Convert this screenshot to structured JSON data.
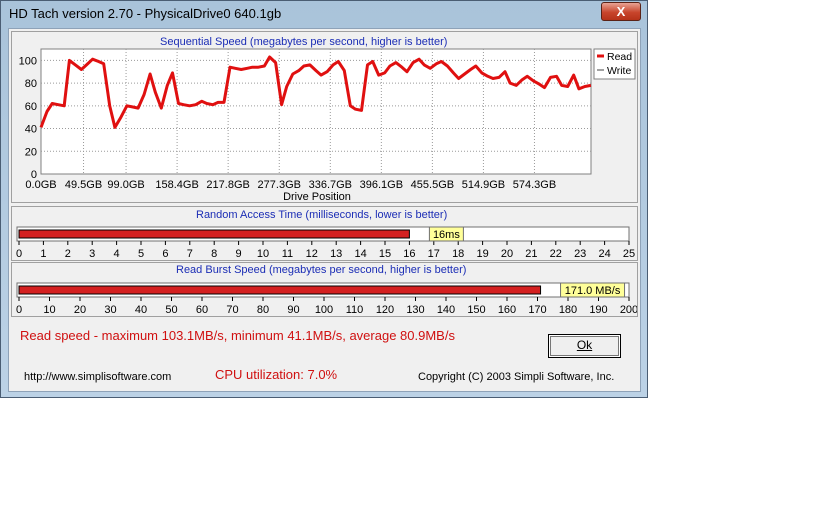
{
  "window": {
    "title": "HD Tach version 2.70 - PhysicalDrive0 640.1gb",
    "close_glyph": "X"
  },
  "sequential": {
    "title": "Sequential Speed (megabytes per second, higher is better)",
    "x_label": "Drive Position",
    "legend": {
      "read": "Read",
      "write": "Write"
    }
  },
  "random_access": {
    "title": "Random Access Time (milliseconds, lower is better)",
    "value_label": "16ms",
    "value": 16
  },
  "burst": {
    "title": "Read Burst Speed (megabytes per second, higher is better)",
    "value_label": "171.0 MB/s",
    "value": 171.0
  },
  "stats": {
    "read_speed": "Read speed - maximum 103.1MB/s, minimum 41.1MB/s, average 80.9MB/s",
    "cpu": "CPU utilization: 7.0%"
  },
  "ok_button": {
    "label": "Ok"
  },
  "footer": {
    "url": "http://www.simplisoftware.com",
    "copyright": "Copyright (C) 2003 Simpli Software, Inc."
  },
  "colors": {
    "read_line": "#e01010",
    "bar_fill": "#d42020",
    "label_bg": "#ffff99",
    "title_blue": "#1b2db5"
  },
  "chart_data": [
    {
      "type": "line",
      "title": "Sequential Speed (megabytes per second, higher is better)",
      "xlabel": "Drive Position",
      "ylabel": "",
      "x_ticks": [
        "0.0GB",
        "49.5GB",
        "99.0GB",
        "158.4GB",
        "217.8GB",
        "277.3GB",
        "336.7GB",
        "396.1GB",
        "455.5GB",
        "514.9GB",
        "574.3GB"
      ],
      "y_ticks": [
        0,
        20,
        40,
        60,
        80,
        100
      ],
      "xlim": [
        0,
        640.1
      ],
      "ylim": [
        0,
        110
      ],
      "grid": true,
      "legend_position": "right",
      "series": [
        {
          "name": "Read",
          "x": [
            0,
            7,
            13,
            20,
            27,
            33,
            40,
            47,
            53,
            60,
            67,
            73,
            80,
            86,
            93,
            100,
            107,
            113,
            120,
            127,
            133,
            140,
            147,
            153,
            160,
            166,
            173,
            180,
            187,
            193,
            200,
            206,
            213,
            220,
            226,
            233,
            240,
            246,
            253,
            260,
            266,
            273,
            280,
            286,
            293,
            300,
            306,
            313,
            320,
            326,
            333,
            340,
            346,
            353,
            360,
            366,
            373,
            380,
            386,
            393,
            400,
            406,
            413,
            420,
            426,
            433,
            440,
            446,
            453,
            460,
            466,
            473,
            480,
            486,
            493,
            500,
            506,
            513,
            520,
            526,
            533,
            540,
            546,
            553,
            560,
            566,
            573,
            580,
            586,
            593,
            600,
            606,
            613,
            620,
            626,
            633,
            640
          ],
          "values": [
            41,
            55,
            62,
            61,
            60,
            100,
            96,
            92,
            96,
            101,
            99,
            97,
            60,
            41,
            50,
            60,
            59,
            58,
            70,
            88,
            72,
            58,
            78,
            89,
            62,
            61,
            60,
            61,
            64,
            62,
            61,
            63,
            63,
            94,
            93,
            92,
            93,
            94,
            94,
            95,
            103,
            98,
            61,
            77,
            88,
            91,
            95,
            96,
            91,
            87,
            90,
            96,
            99,
            91,
            60,
            57,
            56,
            96,
            99,
            87,
            89,
            95,
            98,
            94,
            90,
            98,
            101,
            96,
            93,
            97,
            99,
            95,
            89,
            84,
            88,
            92,
            95,
            89,
            86,
            84,
            85,
            90,
            80,
            78,
            83,
            86,
            82,
            79,
            76,
            85,
            86,
            78,
            77,
            87,
            75,
            77,
            78
          ],
          "color": "#e01010"
        },
        {
          "name": "Write",
          "values": []
        }
      ]
    },
    {
      "type": "bar",
      "title": "Random Access Time (milliseconds, lower is better)",
      "categories": [
        "Read"
      ],
      "values": [
        16
      ],
      "x_ticks": [
        0,
        1,
        2,
        3,
        4,
        5,
        6,
        7,
        8,
        9,
        10,
        11,
        12,
        13,
        14,
        15,
        16,
        17,
        18,
        19,
        20,
        21,
        22,
        23,
        24,
        25
      ],
      "xlim": [
        0,
        25
      ],
      "value_labels": [
        "16ms"
      ]
    },
    {
      "type": "bar",
      "title": "Read Burst Speed (megabytes per second, higher is better)",
      "categories": [
        "Read"
      ],
      "values": [
        171.0
      ],
      "x_ticks": [
        0,
        10,
        20,
        30,
        40,
        50,
        60,
        70,
        80,
        90,
        100,
        110,
        120,
        130,
        140,
        150,
        160,
        170,
        180,
        190,
        200
      ],
      "xlim": [
        0,
        200
      ],
      "value_labels": [
        "171.0 MB/s"
      ]
    }
  ]
}
